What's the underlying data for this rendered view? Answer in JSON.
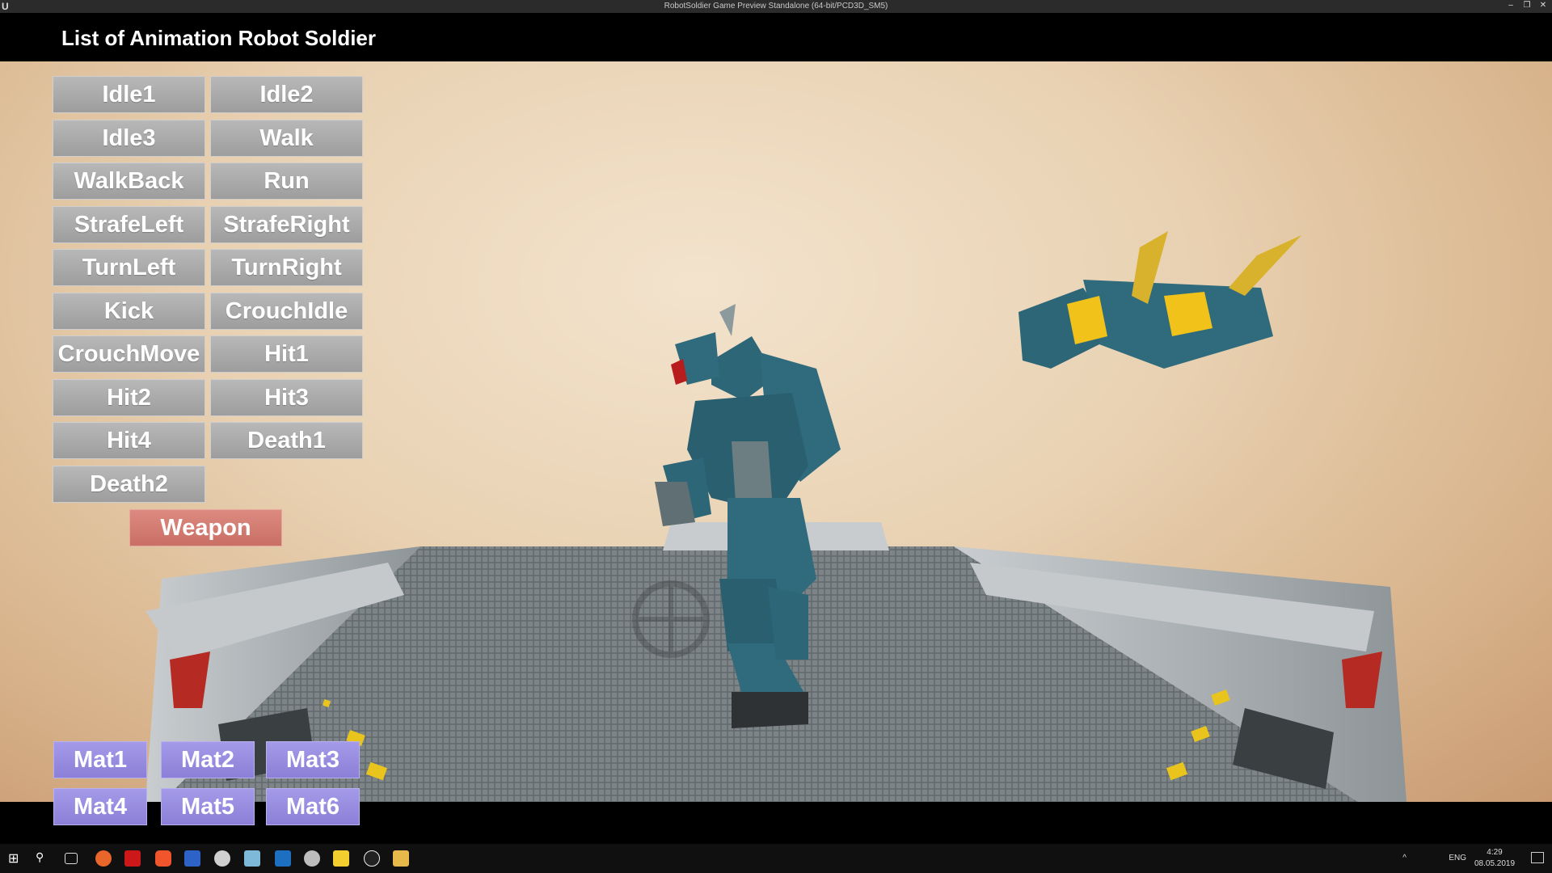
{
  "window": {
    "title": "RobotSoldier Game Preview Standalone (64-bit/PCD3D_SM5)",
    "controls": [
      "–",
      "❐",
      "✕"
    ]
  },
  "header": {
    "title": "List of Animation Robot Soldier"
  },
  "animations": {
    "idle1": "Idle1",
    "idle2": "Idle2",
    "idle3": "Idle3",
    "walk": "Walk",
    "walkback": "WalkBack",
    "run": "Run",
    "strafeleft": "StrafeLeft",
    "straferight": "StrafeRight",
    "turnleft": "TurnLeft",
    "turnright": "TurnRight",
    "kick": "Kick",
    "crouchidle": "CrouchIdle",
    "crouchmove": "CrouchMove",
    "hit1": "Hit1",
    "hit2": "Hit2",
    "hit3": "Hit3",
    "hit4": "Hit4",
    "death1": "Death1",
    "death2": "Death2"
  },
  "weapon_label": "Weapon",
  "materials": {
    "mat1": "Mat1",
    "mat2": "Mat2",
    "mat3": "Mat3",
    "mat4": "Mat4",
    "mat5": "Mat5",
    "mat6": "Mat6"
  },
  "colors": {
    "anim_button": "#a9a9a9",
    "weapon_button": "#d27a70",
    "material_button": "#978ce0",
    "robot_body": "#2c6677",
    "drone_accent": "#f0c21a"
  },
  "taskbar": {
    "icons": [
      "windows-start-icon",
      "search-icon",
      "task-view-icon",
      "firefox-icon",
      "opera-icon",
      "brave-icon",
      "save-icon",
      "shield-icon",
      "paint-icon",
      "vscode-icon",
      "security-icon",
      "sticky-note-icon",
      "unreal-engine-icon",
      "file-explorer-icon"
    ],
    "language": "ENG",
    "time": "4:29",
    "date": "08.05.2019"
  }
}
